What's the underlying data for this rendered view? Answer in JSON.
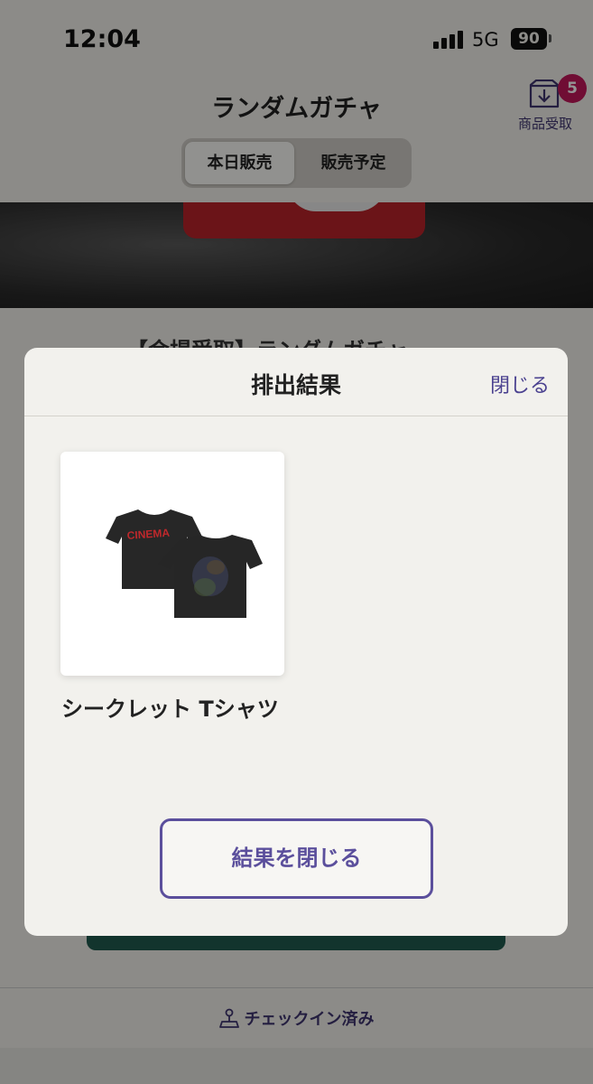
{
  "status_bar": {
    "time": "12:04",
    "network": "5G",
    "battery": "90"
  },
  "header": {
    "title": "ランダムガチャ",
    "receive_label": "商品受取",
    "receive_badge": "5"
  },
  "tabs": [
    {
      "label": "本日販売",
      "active": true
    },
    {
      "label": "販売予定",
      "active": false
    }
  ],
  "event_title_peek": "【会場受取】ランダムガチャ",
  "bottom_bar": {
    "checkin_label": "チェックイン済み"
  },
  "modal": {
    "title": "排出結果",
    "close_label": "閉じる",
    "item": {
      "name": "シークレット Tシャツ",
      "shirt_print": "CINEMA"
    },
    "close_result_label": "結果を閉じる"
  },
  "colors": {
    "accent": "#5b4f9c",
    "badge": "#c2185b",
    "checkin_button": "#1f5a4e",
    "shirt_print": "#c0282c"
  }
}
